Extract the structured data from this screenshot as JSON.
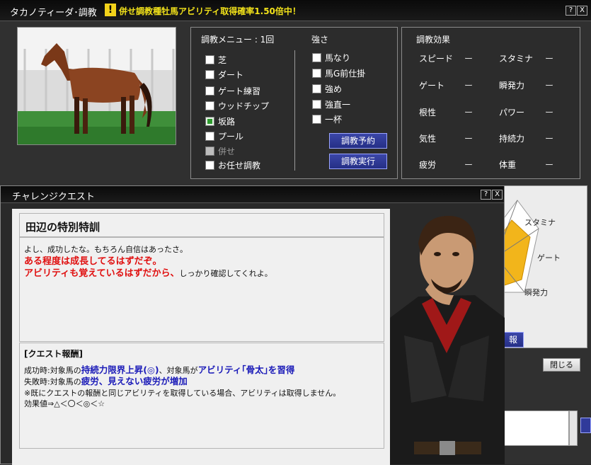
{
  "window": {
    "title": "タカノティーダ･調教",
    "notice": "併せ調教種牡馬アビリティ取得確率1.50倍中！",
    "help_label": "?",
    "close_label": "X"
  },
  "training_menu": {
    "header": "調教メニュー : 1回",
    "items": [
      {
        "label": "芝",
        "state": "unchecked"
      },
      {
        "label": "ダート",
        "state": "unchecked"
      },
      {
        "label": "ゲート練習",
        "state": "unchecked"
      },
      {
        "label": "ウッドチップ",
        "state": "unchecked"
      },
      {
        "label": "坂路",
        "state": "checked"
      },
      {
        "label": "プール",
        "state": "unchecked"
      },
      {
        "label": "併せ",
        "state": "disabled"
      },
      {
        "label": "お任せ調教",
        "state": "unchecked"
      }
    ]
  },
  "strength": {
    "header": "強さ",
    "items": [
      "馬なり",
      "馬G前仕掛",
      "強め",
      "強直一",
      "一杯"
    ]
  },
  "buttons": {
    "reserve": "調教予約",
    "execute": "調教実行",
    "close": "閉じる",
    "partial": "報"
  },
  "effects": {
    "header": "調教効果",
    "rows": [
      {
        "left": "スピード",
        "left_value": "ー",
        "right": "スタミナ",
        "right_value": "ー"
      },
      {
        "left": "ゲート",
        "left_value": "ー",
        "right": "瞬発力",
        "right_value": "ー"
      },
      {
        "left": "根性",
        "left_value": "ー",
        "right": "パワー",
        "right_value": "ー"
      },
      {
        "left": "気性",
        "left_value": "ー",
        "right": "持続力",
        "right_value": "ー"
      },
      {
        "left": "疲労",
        "left_value": "ー",
        "right": "体重",
        "right_value": "ー"
      }
    ]
  },
  "radar": {
    "labels": [
      "スタミナ",
      "ゲート",
      "瞬発力"
    ]
  },
  "quest": {
    "window_title": "チャレンジクエスト",
    "heading": "田辺の特別特訓",
    "line1": "よし、成功したな。もちろん自信はあったさ。",
    "line2": "ある程度は成長してるはずだぞ。",
    "line3_red": "アビリティも覚えているはずだから、",
    "line3_rest": "しっかり確認してくれよ。",
    "reward_header": "[クエスト報酬]",
    "success_prefix": "成功時:対象馬の",
    "success_stat": "持続力限界上昇(◎)",
    "success_mid": "、対象馬が",
    "success_ability": "アビリティ｢骨太｣を習得",
    "fail_prefix": "失敗時:対象馬の",
    "fail_effect": "疲労、見えない疲労が増加",
    "note": "※既にクエストの報酬と同じアビリティを取得している場合、アビリティは取得しません。",
    "effect_scale": "効果値⇒△＜〇＜◎＜☆"
  }
}
